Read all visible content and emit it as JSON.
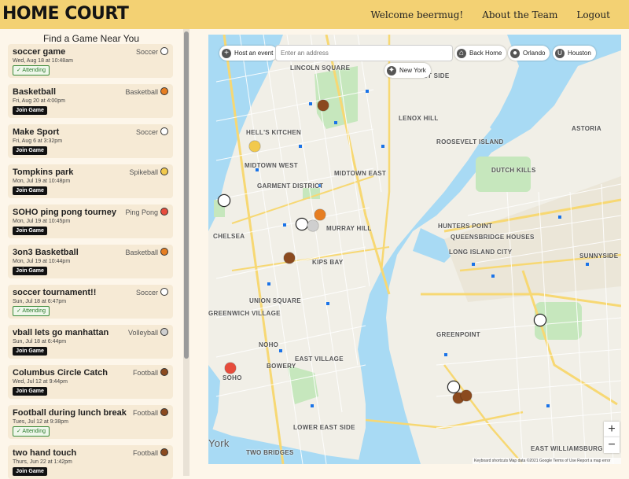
{
  "app": {
    "logo": "HOME COURT"
  },
  "nav": {
    "welcome": "Welcome beermug!",
    "about": "About the Team",
    "logout": "Logout"
  },
  "sidebar": {
    "title": "Find a Game Near You",
    "join_label": "Join Game",
    "attending_label": "✓ Attending",
    "games": [
      {
        "title": "soccer game",
        "sport": "Soccer",
        "date": "Wed, Aug 18 at 10:48am",
        "status": "attending",
        "icon_color": "#ffffff"
      },
      {
        "title": "Basketball",
        "sport": "Basketball",
        "date": "Fri, Aug 20 at 4:00pm",
        "status": "join",
        "icon_color": "#e67e22"
      },
      {
        "title": "Make Sport",
        "sport": "Soccer",
        "date": "Fri, Aug 6 at 3:32pm",
        "status": "join",
        "icon_color": "#ffffff"
      },
      {
        "title": "Tompkins park",
        "sport": "Spikeball",
        "date": "Mon, Jul 19 at 10:48pm",
        "status": "join",
        "icon_color": "#f2c94c"
      },
      {
        "title": "SOHO ping pong tourney",
        "sport": "Ping Pong",
        "date": "Mon, Jul 19 at 10:45pm",
        "status": "join",
        "icon_color": "#e74c3c"
      },
      {
        "title": "3on3 Basketball",
        "sport": "Basketball",
        "date": "Mon, Jul 19 at 10:44pm",
        "status": "join",
        "icon_color": "#e67e22"
      },
      {
        "title": "soccer tournament!!",
        "sport": "Soccer",
        "date": "Sun, Jul 18 at 6:47pm",
        "status": "attending",
        "icon_color": "#ffffff"
      },
      {
        "title": "vball lets go manhattan",
        "sport": "Volleyball",
        "date": "Sun, Jul 18 at 6:44pm",
        "status": "join",
        "icon_color": "#cfcfcf"
      },
      {
        "title": "Columbus Circle Catch",
        "sport": "Football",
        "date": "Wed, Jul 12 at 9:44pm",
        "status": "join",
        "icon_color": "#8b4a1f"
      },
      {
        "title": "Football during lunch break",
        "sport": "Football",
        "date": "Tues, Jul 12 at 9:38pm",
        "status": "attending",
        "icon_color": "#8b4a1f"
      },
      {
        "title": "two hand touch",
        "sport": "Football",
        "date": "Thurs, Jun 22 at 1:42pm",
        "status": "join",
        "icon_color": "#8b4a1f"
      }
    ]
  },
  "map": {
    "host_label": "Host an event",
    "address_placeholder": "Enter an address",
    "back_home": "Back Home",
    "orlando": "Orlando",
    "houston": "Houston",
    "new_york": "New York",
    "zoom_in": "+",
    "zoom_out": "−",
    "attribution": "Keyboard shortcuts    Map data ©2021 Google    Terms of Use    Report a map error",
    "labels": [
      "LINCOLN SQUARE",
      "UPPER EAST SIDE",
      "LENOX HILL",
      "HELL'S KITCHEN",
      "MIDTOWN WEST",
      "MIDTOWN EAST",
      "ROOSEVELT ISLAND",
      "ASTORIA",
      "DUTCH KILLS",
      "GARMENT DISTRICT",
      "MURRAY HILL",
      "HUNTERS POINT",
      "QUEENSBRIDGE HOUSES",
      "CHELSEA",
      "KIPS BAY",
      "LONG ISLAND CITY",
      "SUNNYSIDE",
      "UNION SQUARE",
      "GREENWICH VILLAGE",
      "NOHO",
      "EAST VILLAGE",
      "BOWERY",
      "SOHO",
      "GREENPOINT",
      "LOWER EAST SIDE",
      "TWO BRIDGES",
      "EAST WILLIAMSBURG",
      "York"
    ],
    "pins": [
      "football",
      "spikeball",
      "soccer",
      "soccer",
      "basketball",
      "volleyball",
      "football",
      "soccer",
      "pingpong",
      "soccer",
      "football",
      "football"
    ]
  }
}
